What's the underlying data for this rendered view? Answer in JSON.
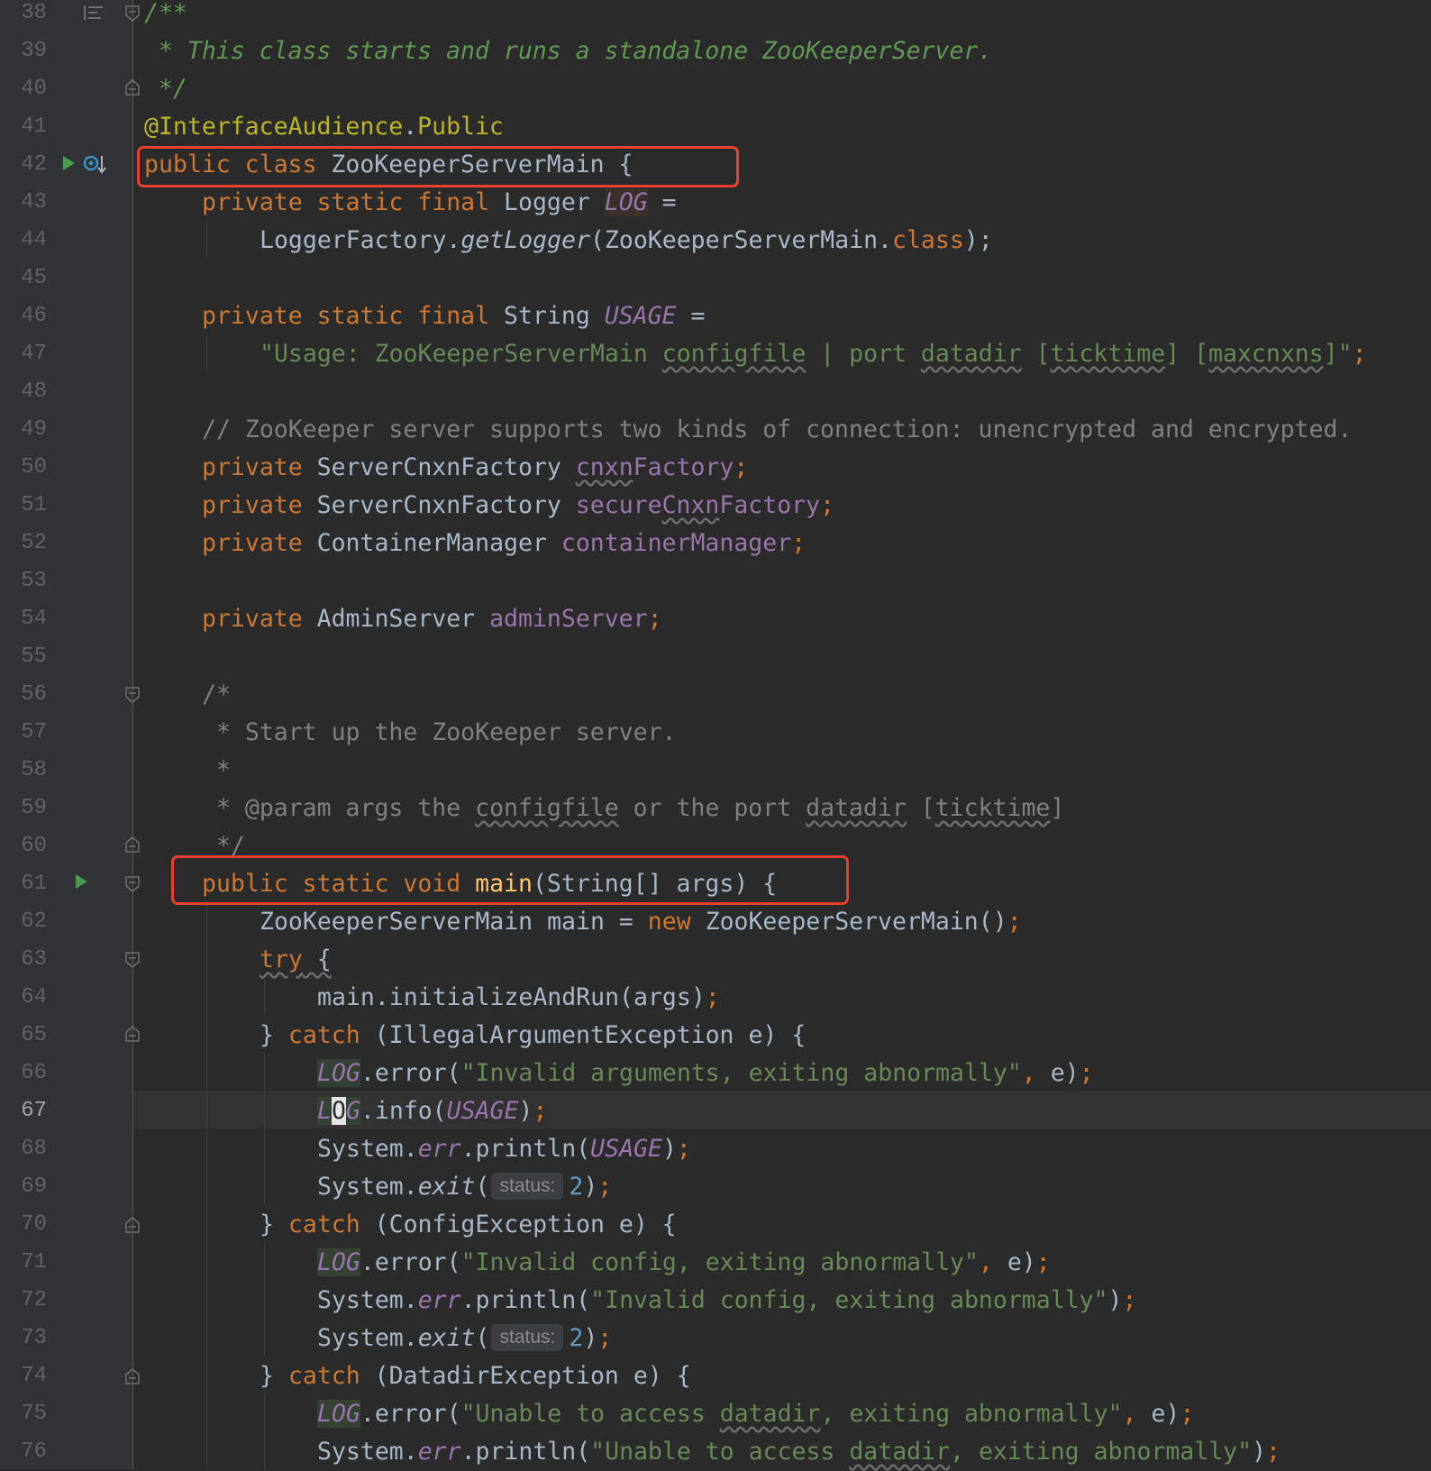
{
  "editor": {
    "current_line": "67",
    "line_numbers": [
      "38",
      "39",
      "40",
      "41",
      "42",
      "43",
      "44",
      "45",
      "46",
      "47",
      "48",
      "49",
      "50",
      "51",
      "52",
      "53",
      "54",
      "55",
      "56",
      "57",
      "58",
      "59",
      "60",
      "61",
      "62",
      "63",
      "64",
      "65",
      "66",
      "67",
      "68",
      "69",
      "70",
      "71",
      "72",
      "73",
      "74",
      "75",
      "76"
    ],
    "code": {
      "l38": "/**",
      "l39": " * This class starts and runs a standalone ZooKeeperServer.",
      "l40": " */",
      "l41_ann": "@InterfaceAudience",
      "l41_dot": ".",
      "l41_public": "Public",
      "l42_kw": "public class ",
      "l42_name": "ZooKeeperServerMain {",
      "l43_kw": "private static final ",
      "l43_type": "Logger ",
      "l43_field": "LOG",
      "l43_eq": " =",
      "l44_a": "LoggerFactory.",
      "l44_m": "getLogger",
      "l44_b": "(ZooKeeperServerMain.",
      "l44_kw": "class",
      "l44_c": ");",
      "l46_kw": "private static final ",
      "l46_type": "String ",
      "l46_field": "USAGE",
      "l46_eq": " =",
      "l47_s1": "\"Usage: ZooKeeperServerMain ",
      "l47_w1": "configfile",
      "l47_s2": " | port ",
      "l47_w2": "datadir",
      "l47_s3": " [",
      "l47_w3": "ticktime",
      "l47_s4": "] [",
      "l47_w4": "maxcnxns",
      "l47_s5": "]\"",
      "l47_semi": ";",
      "l49": "// ZooKeeper server supports two kinds of connection: unencrypted and encrypted.",
      "l50_kw": "private ",
      "l50_type": "ServerCnxnFactory ",
      "l50_w": "cnxn",
      "l50_field": "Factory",
      "l50_semi": ";",
      "l51_kw": "private ",
      "l51_type": "ServerCnxnFactory ",
      "l51_f1": "secure",
      "l51_w": "Cnxn",
      "l51_f2": "Factory",
      "l51_semi": ";",
      "l52_kw": "private ",
      "l52_type": "ContainerManager ",
      "l52_field": "containerManager",
      "l52_semi": ";",
      "l54_kw": "private ",
      "l54_type": "AdminServer ",
      "l54_field": "adminServer",
      "l54_semi": ";",
      "l56": "/*",
      "l57": " * Start up the ZooKeeper server.",
      "l58": " *",
      "l59_a": " * @param args the ",
      "l59_w1": "configfile",
      "l59_b": " or the port ",
      "l59_w2": "datadir",
      "l59_c": " [",
      "l59_w3": "ticktime",
      "l59_d": "]",
      "l60": " */",
      "l61_kw": "public static void ",
      "l61_fn": "main",
      "l61_rest": "(String[] args) {",
      "l62_a": "ZooKeeperServerMain main = ",
      "l62_kw": "new ",
      "l62_b": "ZooKeeperServerMain()",
      "l62_semi": ";",
      "l63_kw": "try",
      "l63_b": " {",
      "l64_a": "main.initializeAndRun(args)",
      "l64_semi": ";",
      "l65_a": "} ",
      "l65_kw": "catch ",
      "l65_b": "(IllegalArgumentException e) {",
      "l66_f": "LOG",
      "l66_a": ".error(",
      "l66_s": "\"Invalid arguments, exiting abnormally\"",
      "l66_c": ", ",
      "l66_b": "e)",
      "l66_semi": ";",
      "l67_f1": "L",
      "l67_caret": "O",
      "l67_f2": "G",
      "l67_a": ".info(",
      "l67_f3": "USAGE",
      "l67_b": ")",
      "l67_semi": ";",
      "l68_a": "System.",
      "l68_f": "err",
      "l68_b": ".println(",
      "l68_f2": "USAGE",
      "l68_c": ")",
      "l68_semi": ";",
      "l69_a": "System.",
      "l69_m": "exit",
      "l69_b": "(",
      "l69_hint": "status:",
      "l69_num": "2",
      "l69_c": ")",
      "l69_semi": ";",
      "l70_a": "} ",
      "l70_kw": "catch ",
      "l70_b": "(ConfigException e) {",
      "l71_f": "LOG",
      "l71_a": ".error(",
      "l71_s": "\"Invalid config, exiting abnormally\"",
      "l71_c": ", ",
      "l71_b": "e)",
      "l71_semi": ";",
      "l72_a": "System.",
      "l72_f": "err",
      "l72_b": ".println(",
      "l72_s": "\"Invalid config, exiting abnormally\"",
      "l72_c": ")",
      "l72_semi": ";",
      "l73_a": "System.",
      "l73_m": "exit",
      "l73_b": "(",
      "l73_hint": "status:",
      "l73_num": "2",
      "l73_c": ")",
      "l73_semi": ";",
      "l74_a": "} ",
      "l74_kw": "catch ",
      "l74_b": "(DatadirException e) {",
      "l75_f": "LOG",
      "l75_a": ".error(",
      "l75_s1": "\"Unable to access ",
      "l75_w": "datadir",
      "l75_s2": ", exiting abnormally\"",
      "l75_c": ", ",
      "l75_b": "e)",
      "l75_semi": ";",
      "l76_a": "System.",
      "l76_f": "err",
      "l76_b": ".println(",
      "l76_s1": "\"Unable to access ",
      "l76_w": "datadir",
      "l76_s2": ", exiting abnormally\"",
      "l76_c": ")",
      "l76_semi": ";"
    }
  },
  "icons": {
    "run": "run-gutter-icon",
    "override": "implemented-by-icon",
    "fold": "fold-icon",
    "structure": "structure-icon"
  },
  "colors": {
    "highlight_box": "#e8402f",
    "keyword": "#cc7832",
    "string": "#6a8759",
    "field": "#9876aa",
    "doc_comment": "#629755",
    "run_icon": "#499c54"
  }
}
